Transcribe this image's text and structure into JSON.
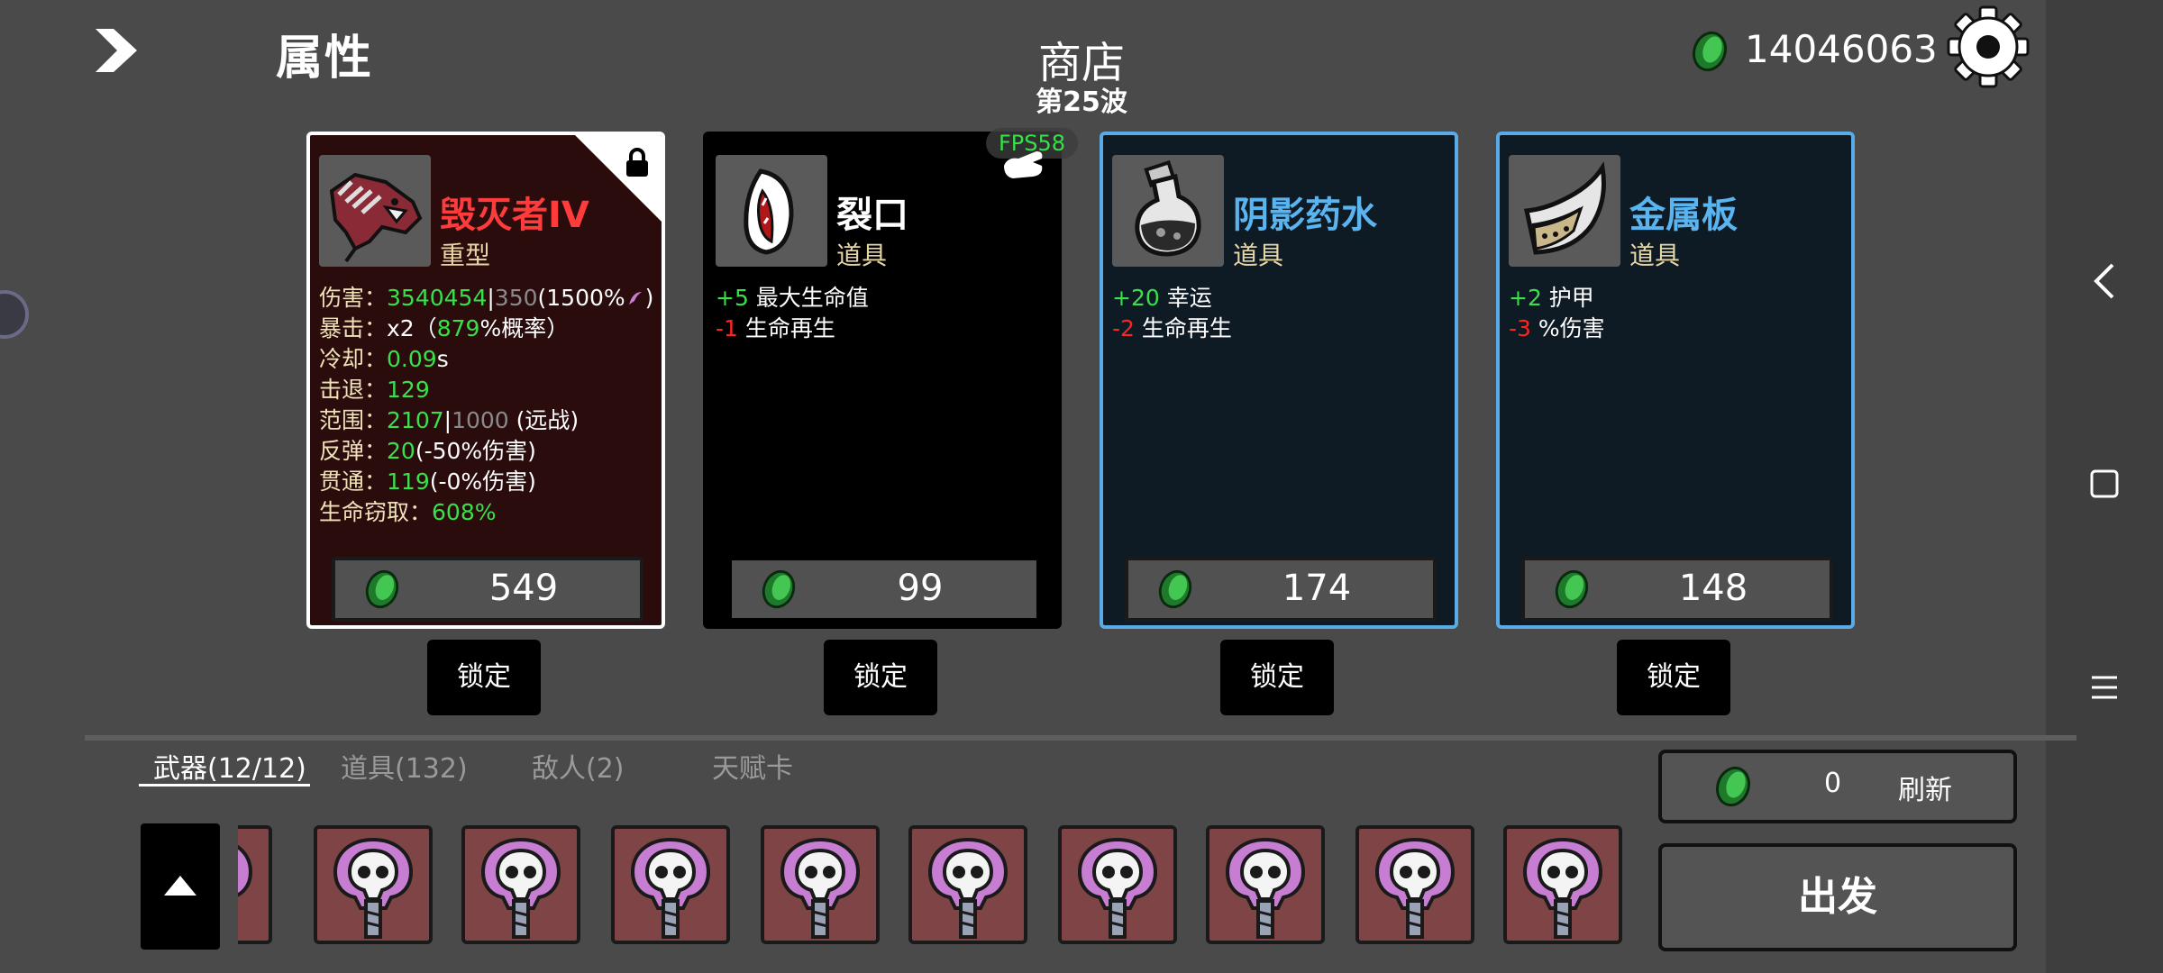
{
  "header": {
    "stats_title": "属性",
    "shop_title": "商店",
    "wave_label": "第25波",
    "currency": "14046063"
  },
  "overlay": {
    "fps": "FPS58"
  },
  "cards": [
    {
      "name": "毁灭者IV",
      "type": "重型",
      "locked": true,
      "name_color": "#ff3b3b",
      "price": "549",
      "stats": {
        "damage_label": "伤害：",
        "damage_value": "3540454",
        "damage_sep": "|",
        "damage_base": "350",
        "damage_extra": "(1500%",
        "damage_close": ")",
        "crit_label": "暴击：",
        "crit_mult": "x2（",
        "crit_chance": "879",
        "crit_suffix": "%概率）",
        "cooldown_label": "冷却：",
        "cooldown_value": "0.09",
        "cooldown_unit": "s",
        "knockback_label": "击退：",
        "knockback_value": "129",
        "range_label": "范围：",
        "range_value": "2107",
        "range_sep": "|",
        "range_base": "1000",
        "range_suffix": " (远战)",
        "bounce_label": "反弹：",
        "bounce_value": "20",
        "bounce_suffix": "(-50%伤害)",
        "pierce_label": "贯通：",
        "pierce_value": "119",
        "pierce_suffix": "(-0%伤害)",
        "lifesteal_label": "生命窃取：",
        "lifesteal_value": "608%"
      }
    },
    {
      "name": "裂口",
      "type": "道具",
      "name_color": "#ffffff",
      "price": "99",
      "effects": [
        {
          "value": "+5",
          "label": " 最大生命值",
          "color": "#38e04a"
        },
        {
          "value": "-1",
          "label": " 生命再生",
          "color": "#ff2222"
        }
      ]
    },
    {
      "name": "阴影药水",
      "type": "道具",
      "name_color": "#5ab4f0",
      "price": "174",
      "effects": [
        {
          "value": "+20",
          "label": " 幸运",
          "color": "#38e04a"
        },
        {
          "value": "-2",
          "label": " 生命再生",
          "color": "#ff2222"
        }
      ]
    },
    {
      "name": "金属板",
      "type": "道具",
      "name_color": "#5ab4f0",
      "price": "148",
      "effects": [
        {
          "value": "+2",
          "label": " 护甲",
          "color": "#38e04a"
        },
        {
          "value": "-3",
          "label": " %伤害",
          "color": "#ff2222"
        }
      ]
    }
  ],
  "lock_button_label": "锁定",
  "tabs": [
    {
      "label": "武器(12/12)",
      "active": true
    },
    {
      "label": "道具(132)",
      "active": false
    },
    {
      "label": "敌人(2)",
      "active": false
    },
    {
      "label": "天赋卡",
      "active": false
    }
  ],
  "refresh": {
    "cost": "0",
    "label": "刷新"
  },
  "go_label": "出发",
  "icons": {
    "nav": "chevron-right-icon",
    "currency": "green-coin-icon",
    "settings": "gear-icon",
    "lock": "lock-icon",
    "scroll": "arrow-up-icon"
  },
  "colors": {
    "green": "#38e04a",
    "red": "#ff2222",
    "blue_border": "#5aaae6",
    "weapon_bg": "#2a0c0d",
    "inventory_slot": "#7e4446"
  }
}
